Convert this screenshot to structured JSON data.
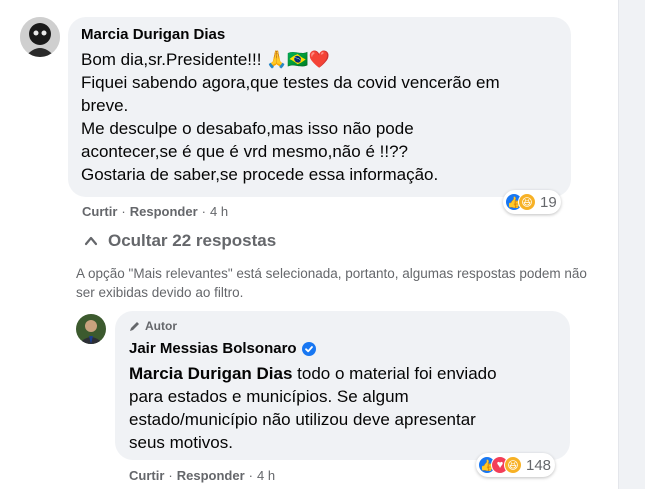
{
  "comment": {
    "author": "Marcia Durigan Dias",
    "lines": [
      "Bom dia,sr.Presidente!!! 🙏🇧🇷❤️",
      "Fiquei sabendo agora,que testes da covid vencerão em",
      "breve.",
      "Me desculpe o desabafo,mas isso não pode",
      "acontecer,se é que é vrd mesmo,não é !!??",
      "Gostaria de saber,se procede essa informação."
    ],
    "like_label": "Curtir",
    "reply_label": "Responder",
    "time": "4 h",
    "reaction_count": "19",
    "reactions": [
      "like-icon",
      "haha-icon"
    ]
  },
  "replies_toggle": {
    "label": "Ocultar 22 respostas",
    "icon": "chevron-up-icon"
  },
  "filter_notice": "A opção \"Mais relevantes\" está selecionada, portanto, algumas respostas podem não ser exibidas devido ao filtro.",
  "reply": {
    "badge": "Autor",
    "badge_icon": "pencil-icon",
    "author": "Jair Messias Bolsonaro",
    "verified_icon": "verified-badge-icon",
    "mention": "Marcia Durigan Dias",
    "text_first": " todo o material foi enviado",
    "lines": [
      "para estados e municípios. Se algum",
      "estado/município não utilizou deve apresentar",
      "seus motivos."
    ],
    "like_label": "Curtir",
    "reply_label": "Responder",
    "time": "4 h",
    "reaction_count": "148",
    "reactions": [
      "like-icon",
      "love-icon",
      "haha-icon"
    ]
  },
  "colors": {
    "bubble": "#f0f2f5",
    "muted_text": "#65676b",
    "like": "#1877f2",
    "love": "#f33e58",
    "haha": "#f7b125"
  }
}
